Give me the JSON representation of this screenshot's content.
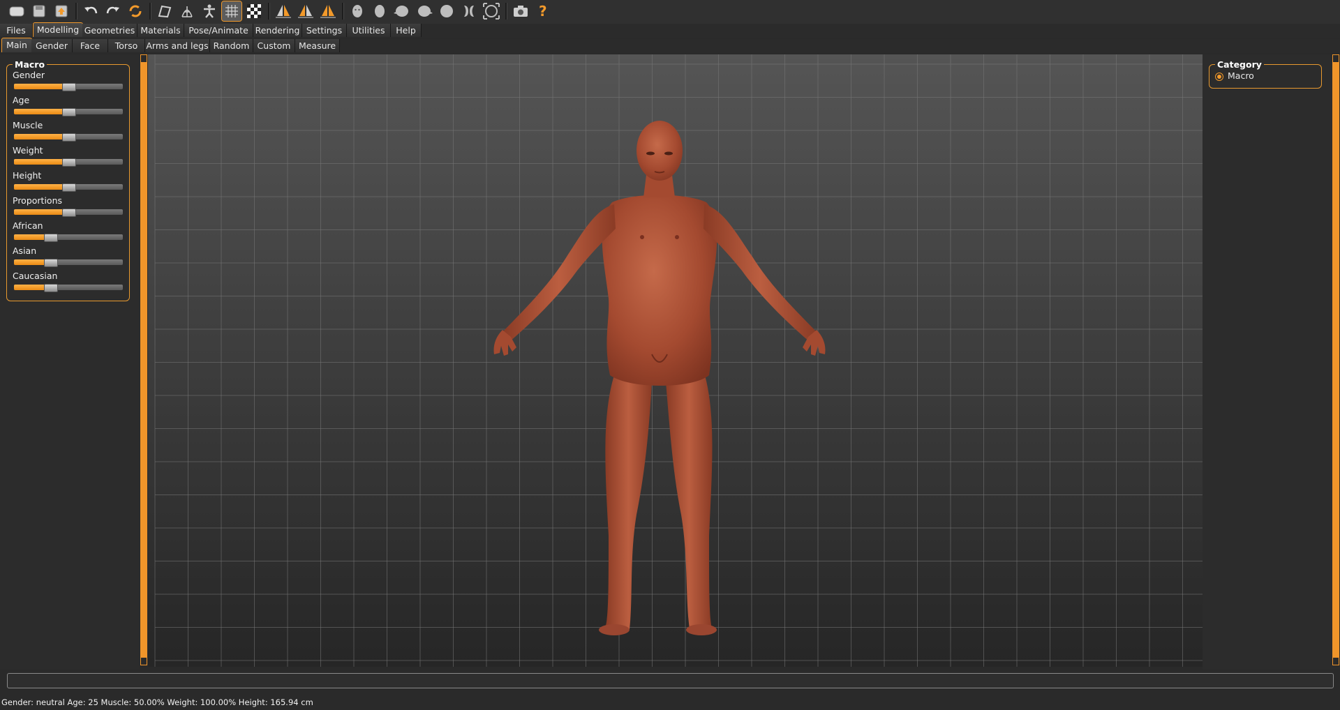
{
  "toolbar": {
    "buttons": [
      {
        "name": "new-icon"
      },
      {
        "name": "save-icon"
      },
      {
        "name": "export-icon"
      },
      {
        "name": "undo-icon"
      },
      {
        "name": "redo-icon"
      },
      {
        "name": "reset-icon"
      },
      {
        "name": "smooth-icon"
      },
      {
        "name": "wireframe-icon"
      },
      {
        "name": "pose-icon"
      },
      {
        "name": "grid-icon",
        "active": true
      },
      {
        "name": "background-checker-icon"
      },
      {
        "name": "symmetry-right-icon"
      },
      {
        "name": "symmetry-left-icon"
      },
      {
        "name": "symmetry-icon"
      },
      {
        "name": "front-view-icon"
      },
      {
        "name": "back-view-icon"
      },
      {
        "name": "left-view-icon"
      },
      {
        "name": "right-view-icon"
      },
      {
        "name": "top-view-icon"
      },
      {
        "name": "bottom-view-icon"
      },
      {
        "name": "reset-camera-icon"
      },
      {
        "name": "screenshot-icon"
      },
      {
        "name": "help-icon"
      }
    ]
  },
  "main_tabs": [
    "Files",
    "Modelling",
    "Geometries",
    "Materials",
    "Pose/Animate",
    "Rendering",
    "Settings",
    "Utilities",
    "Help"
  ],
  "main_tab_active": "Modelling",
  "sub_tabs": [
    "Main",
    "Gender",
    "Face",
    "Torso",
    "Arms and legs",
    "Random",
    "Custom",
    "Measure"
  ],
  "sub_tab_active": "Main",
  "macro": {
    "title": "Macro",
    "sliders": [
      {
        "label": "Gender",
        "value": 0.5
      },
      {
        "label": "Age",
        "value": 0.5
      },
      {
        "label": "Muscle",
        "value": 0.5
      },
      {
        "label": "Weight",
        "value": 0.5
      },
      {
        "label": "Height",
        "value": 0.5
      },
      {
        "label": "Proportions",
        "value": 0.5
      },
      {
        "label": "African",
        "value": 0.333
      },
      {
        "label": "Asian",
        "value": 0.333
      },
      {
        "label": "Caucasian",
        "value": 0.333
      }
    ]
  },
  "category": {
    "title": "Category",
    "options": [
      {
        "label": "Macro",
        "selected": true
      }
    ]
  },
  "status_text": "Gender: neutral Age: 25 Muscle: 50.00% Weight: 100.00% Height: 165.94 cm",
  "colors": {
    "accent": "#f39a2b",
    "skin": "#b4563b"
  }
}
